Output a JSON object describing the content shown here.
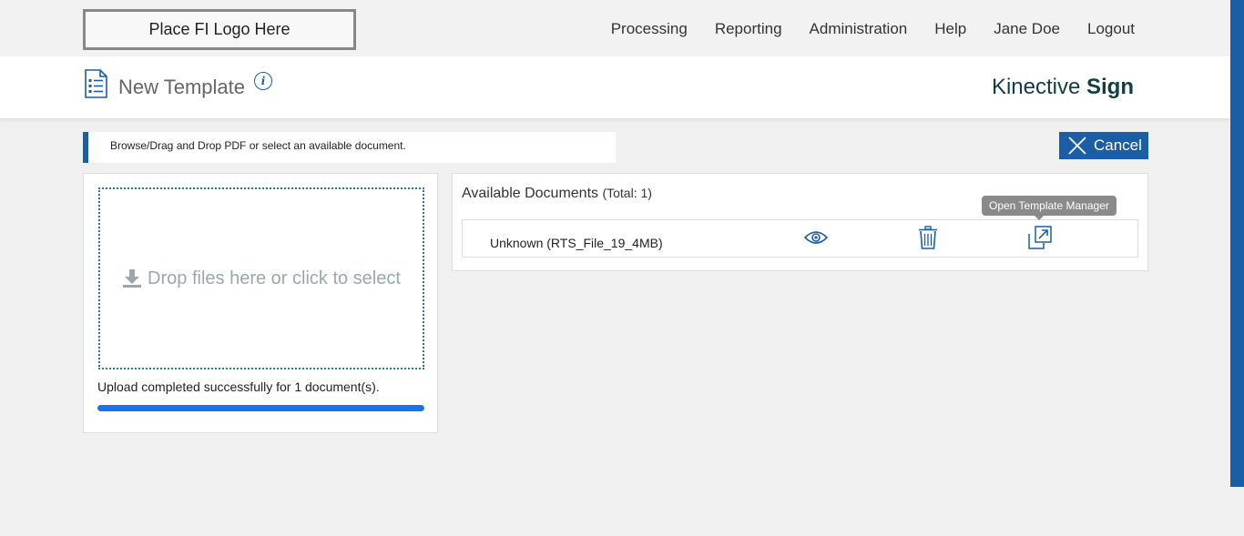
{
  "topbar": {
    "logo_text": "Place FI Logo Here",
    "nav": [
      "Processing",
      "Reporting",
      "Administration",
      "Help",
      "Jane Doe",
      "Logout"
    ]
  },
  "header": {
    "title": "New Template",
    "brand_light": "Kinective",
    "brand_bold": "Sign"
  },
  "hint": "Browse/Drag and Drop PDF or select an available document.",
  "cancel_label": "Cancel",
  "upload": {
    "dropzone_text": "Drop files here or click to select",
    "status": "Upload completed successfully for 1 document(s).",
    "progress_percent": 100
  },
  "documents": {
    "title": "Available Documents",
    "total": "(Total: 1)",
    "rows": [
      {
        "name": "Unknown (RTS_File_19_4MB)"
      }
    ]
  },
  "tooltip": "Open Template Manager",
  "colors": {
    "accent": "#1a5fa6",
    "progress": "#1a73e8",
    "brand_text": "#123d45"
  },
  "icons": [
    "document-list-icon",
    "info-icon",
    "close-x-icon",
    "download-icon",
    "eye-icon",
    "trash-icon",
    "open-external-icon"
  ]
}
